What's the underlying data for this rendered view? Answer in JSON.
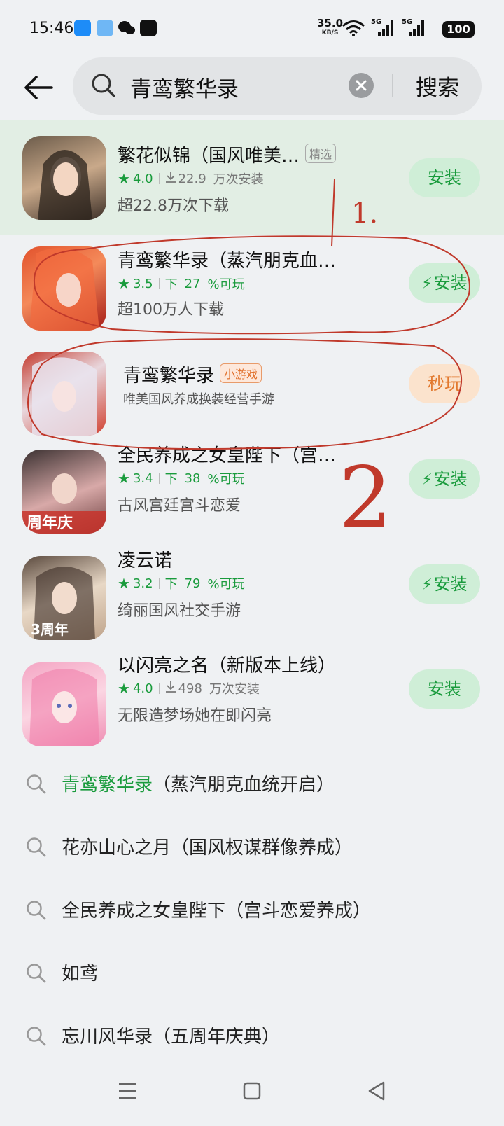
{
  "status": {
    "time": "15:46",
    "net_speed": "35.0",
    "net_unit": "KB/S",
    "sig1": "5G",
    "sig2": "5G",
    "battery": "100"
  },
  "search": {
    "query": "青鸾繁华录",
    "submit_label": "搜索"
  },
  "apps": [
    {
      "title": "繁花似锦（国风唯美…",
      "tag": "精选",
      "rating": "4.0",
      "downloads": "22.9",
      "downloads_label": "万次安装",
      "desc": "超22.8万次下载",
      "button": "安装"
    },
    {
      "title": "青鸾繁华录（蒸汽朋克血…",
      "rating": "3.5",
      "dl_prefix": "下",
      "downloads": "27",
      "downloads_label": "%可玩",
      "desc": "超100万人下载",
      "button": "安装"
    },
    {
      "title": "青鸾繁华录",
      "tag": "小游戏",
      "desc": "唯美国风养成换装经营手游",
      "button": "秒玩"
    },
    {
      "title": "全民养成之女皇陛下（宫…",
      "rating": "3.4",
      "dl_prefix": "下",
      "downloads": "38",
      "downloads_label": "%可玩",
      "desc": "古风宫廷宫斗恋爱",
      "button": "安装",
      "icon_text": "周年庆"
    },
    {
      "title": "凌云诺",
      "rating": "3.2",
      "dl_prefix": "下",
      "downloads": "79",
      "downloads_label": "%可玩",
      "desc": "绮丽国风社交手游",
      "button": "安装",
      "icon_text": "3周年"
    },
    {
      "title": "以闪亮之名（新版本上线）",
      "rating": "4.0",
      "downloads": "498",
      "downloads_label": "万次安装",
      "desc": "无限造梦场她在即闪亮",
      "button": "安装"
    }
  ],
  "suggestions": [
    {
      "highlight": "青鸾繁华录",
      "rest": "（蒸汽朋克血统开启）"
    },
    {
      "highlight": "",
      "rest": "花亦山心之月（国风权谋群像养成）"
    },
    {
      "highlight": "",
      "rest": "全民养成之女皇陛下（宫斗恋爱养成）"
    },
    {
      "highlight": "",
      "rest": "如鸢"
    },
    {
      "highlight": "",
      "rest": "忘川风华录（五周年庆典）"
    }
  ],
  "annotations": {
    "mark1": "1.",
    "mark2": "2"
  },
  "colors": {
    "accent_green": "#199b3c",
    "install_bg": "#cfeed7",
    "play_orange": "#e2792e",
    "annotation_red": "#c0392b"
  }
}
